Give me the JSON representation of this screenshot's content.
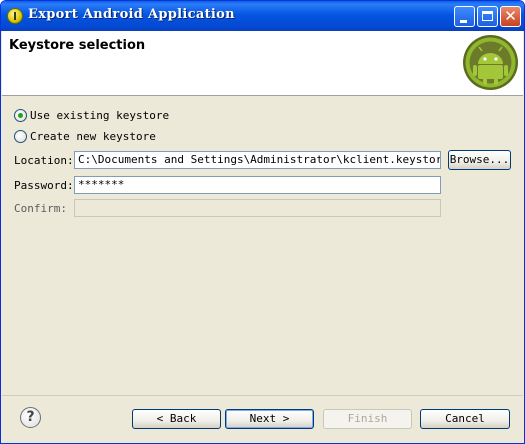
{
  "window": {
    "title": "Export Android Application",
    "minimize_icon": "minimize-icon",
    "maximize_icon": "maximize-icon",
    "close_icon": "close-icon"
  },
  "header": {
    "title": "Keystore selection",
    "logo": "android-logo"
  },
  "options": {
    "use_existing": {
      "label": "Use existing keystore",
      "checked": true
    },
    "create_new": {
      "label": "Create new keystore",
      "checked": false
    }
  },
  "form": {
    "location": {
      "label": "Location:",
      "value": "C:\\Documents and Settings\\Administrator\\kclient.keystore"
    },
    "browse_label": "Browse...",
    "password": {
      "label": "Password:",
      "value": "*******"
    },
    "confirm": {
      "label": "Confirm:",
      "value": ""
    }
  },
  "footer": {
    "help_icon": "?",
    "back_label": "< Back",
    "next_label": "Next >",
    "finish_label": "Finish",
    "cancel_label": "Cancel"
  },
  "colors": {
    "titlebar": "#0556e3",
    "dialog_bg": "#ece9d8",
    "radio_dot": "#21a121"
  }
}
